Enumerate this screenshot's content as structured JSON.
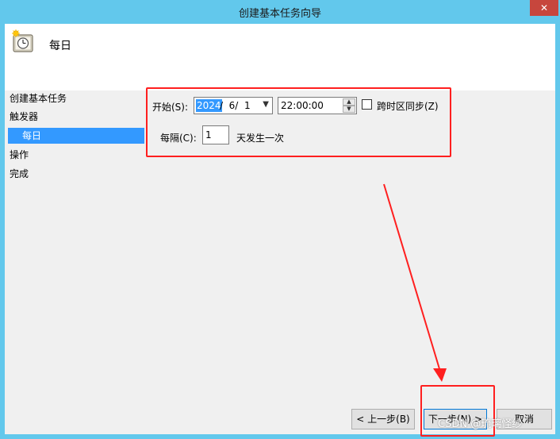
{
  "window": {
    "title": "创建基本任务向导",
    "close_label": "✕"
  },
  "header": {
    "title": "每日"
  },
  "sidebar": {
    "items": [
      {
        "label": "创建基本任务"
      },
      {
        "label": "触发器"
      },
      {
        "label": "每日"
      },
      {
        "label": "操作"
      },
      {
        "label": "完成"
      }
    ]
  },
  "form": {
    "start_label": "开始(S):",
    "date_year": "2024",
    "date_rest": "/  6/  1",
    "time_value": "22:00:00",
    "timezone_label": "跨时区同步(Z)",
    "interval_label": "每隔(C):",
    "interval_value": "1",
    "interval_suffix": "天发生一次"
  },
  "buttons": {
    "back_label": "< 上一步(B)",
    "next_label": "下一步(N) >",
    "cancel_label": "取消"
  },
  "watermark": "CSDN @琉璃怪纱",
  "colors": {
    "selection": "#3399ff",
    "annotation": "#ff1f1f",
    "titlebar": "#62c8ec",
    "close": "#c7463d"
  }
}
